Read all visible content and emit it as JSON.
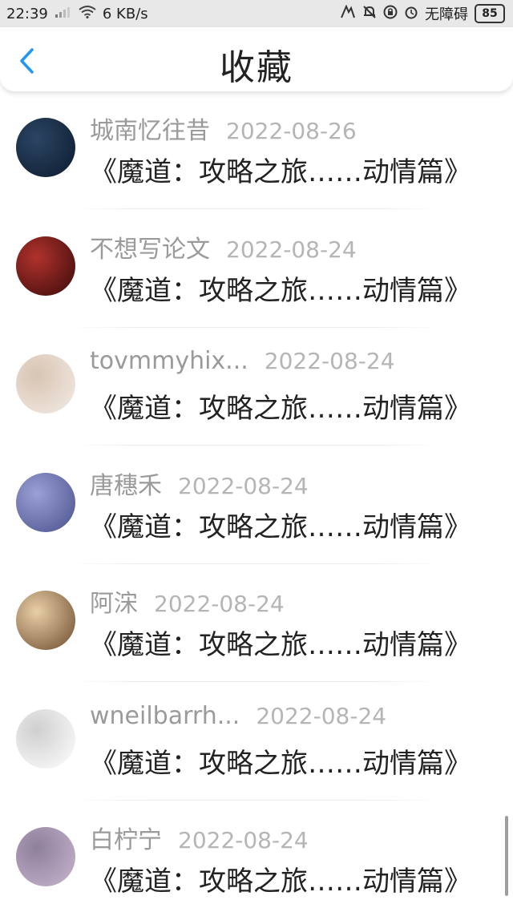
{
  "status_bar": {
    "time": "22:39",
    "network_speed": "6 KB/s",
    "accessibility": "无障碍",
    "battery": "85",
    "icons": [
      "signal-icon",
      "wifi-icon",
      "link-icon",
      "bell-icon",
      "lock-icon",
      "alarm-icon"
    ]
  },
  "header": {
    "title": "收藏",
    "back_icon": "chevron-left-icon"
  },
  "favorites": [
    {
      "user": "城南忆往昔",
      "date": "2022-08-26",
      "title": "《魔道：攻略之旅……动情篇》",
      "avatar_colors": [
        "#0b1a2e",
        "#2c4563"
      ]
    },
    {
      "user": "不想写论文",
      "date": "2022-08-24",
      "title": "《魔道：攻略之旅……动情篇》",
      "avatar_colors": [
        "#3a0a0a",
        "#b0322c"
      ]
    },
    {
      "user": "tovmmyhix...",
      "date": "2022-08-24",
      "title": "《魔道：攻略之旅……动情篇》",
      "avatar_colors": [
        "#f3ece6",
        "#d8c4b2"
      ]
    },
    {
      "user": "唐穗禾",
      "date": "2022-08-24",
      "title": "《魔道：攻略之旅……动情篇》",
      "avatar_colors": [
        "#4a4f8a",
        "#9aa1d6"
      ]
    },
    {
      "user": "阿浨",
      "date": "2022-08-24",
      "title": "《魔道：攻略之旅……动情篇》",
      "avatar_colors": [
        "#6b4a2c",
        "#e9cfa8"
      ]
    },
    {
      "user": "wneilbarrh...",
      "date": "2022-08-24",
      "title": "《魔道：攻略之旅……动情篇》",
      "avatar_colors": [
        "#ffffff",
        "#cfcfcf"
      ]
    },
    {
      "user": "白柠宁",
      "date": "2022-08-24",
      "title": "《魔道：攻略之旅……动情篇》",
      "avatar_colors": [
        "#c9b6cf",
        "#8e7f9c"
      ]
    }
  ]
}
